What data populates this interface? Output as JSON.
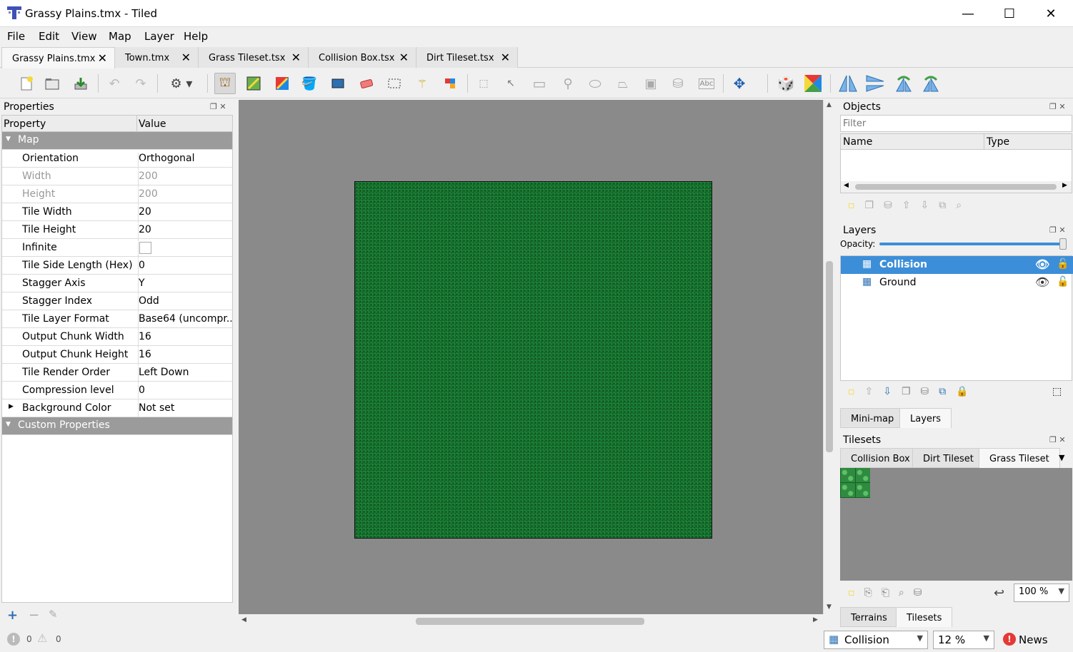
{
  "window": {
    "title": "Grassy Plains.tmx - Tiled",
    "minimize": "—",
    "maximize": "☐",
    "close": "✕"
  },
  "menu": [
    "File",
    "Edit",
    "View",
    "Map",
    "Layer",
    "Help"
  ],
  "tabs": [
    {
      "label": "Grassy Plains.tmx",
      "active": true
    },
    {
      "label": "Town.tmx"
    },
    {
      "label": "Grass Tileset.tsx"
    },
    {
      "label": "Collision Box.tsx"
    },
    {
      "label": "Dirt Tileset.tsx"
    }
  ],
  "properties": {
    "title": "Properties",
    "col_property": "Property",
    "col_value": "Value",
    "group_map": "Map",
    "rows": [
      {
        "key": "Orientation",
        "value": "Orthogonal"
      },
      {
        "key": "Width",
        "value": "200",
        "disabled": true
      },
      {
        "key": "Height",
        "value": "200",
        "disabled": true
      },
      {
        "key": "Tile Width",
        "value": "20"
      },
      {
        "key": "Tile Height",
        "value": "20"
      },
      {
        "key": "Infinite",
        "value": ""
      },
      {
        "key": "Tile Side Length (Hex)",
        "value": "0"
      },
      {
        "key": "Stagger Axis",
        "value": "Y"
      },
      {
        "key": "Stagger Index",
        "value": "Odd"
      },
      {
        "key": "Tile Layer Format",
        "value": "Base64 (uncompr..."
      },
      {
        "key": "Output Chunk Width",
        "value": "16"
      },
      {
        "key": "Output Chunk Height",
        "value": "16"
      },
      {
        "key": "Tile Render Order",
        "value": "Left Down"
      },
      {
        "key": "Compression level",
        "value": "0"
      },
      {
        "key": "Background Color",
        "value": "Not set"
      }
    ],
    "group_custom": "Custom Properties"
  },
  "objects": {
    "title": "Objects",
    "filter_placeholder": "Filter",
    "col_name": "Name",
    "col_type": "Type"
  },
  "layers": {
    "title": "Layers",
    "opacity_label": "Opacity:",
    "opacity": 1.0,
    "items": [
      {
        "name": "Collision",
        "selected": true
      },
      {
        "name": "Ground"
      }
    ],
    "tabs": [
      "Mini-map",
      "Layers"
    ]
  },
  "tilesets": {
    "title": "Tilesets",
    "tabs": [
      "Collision Box",
      "Dirt Tileset",
      "Grass Tileset"
    ],
    "zoom": "100 %",
    "bottom_tabs": [
      "Terrains",
      "Tilesets"
    ]
  },
  "status": {
    "errors": "0",
    "warnings": "0",
    "layer": "Collision",
    "zoom": "12 %",
    "news": "News"
  },
  "colors": {
    "accent": "#3c8ed8",
    "map_green": "#1e8a3a",
    "canvas_bg": "#8a8a8a"
  }
}
